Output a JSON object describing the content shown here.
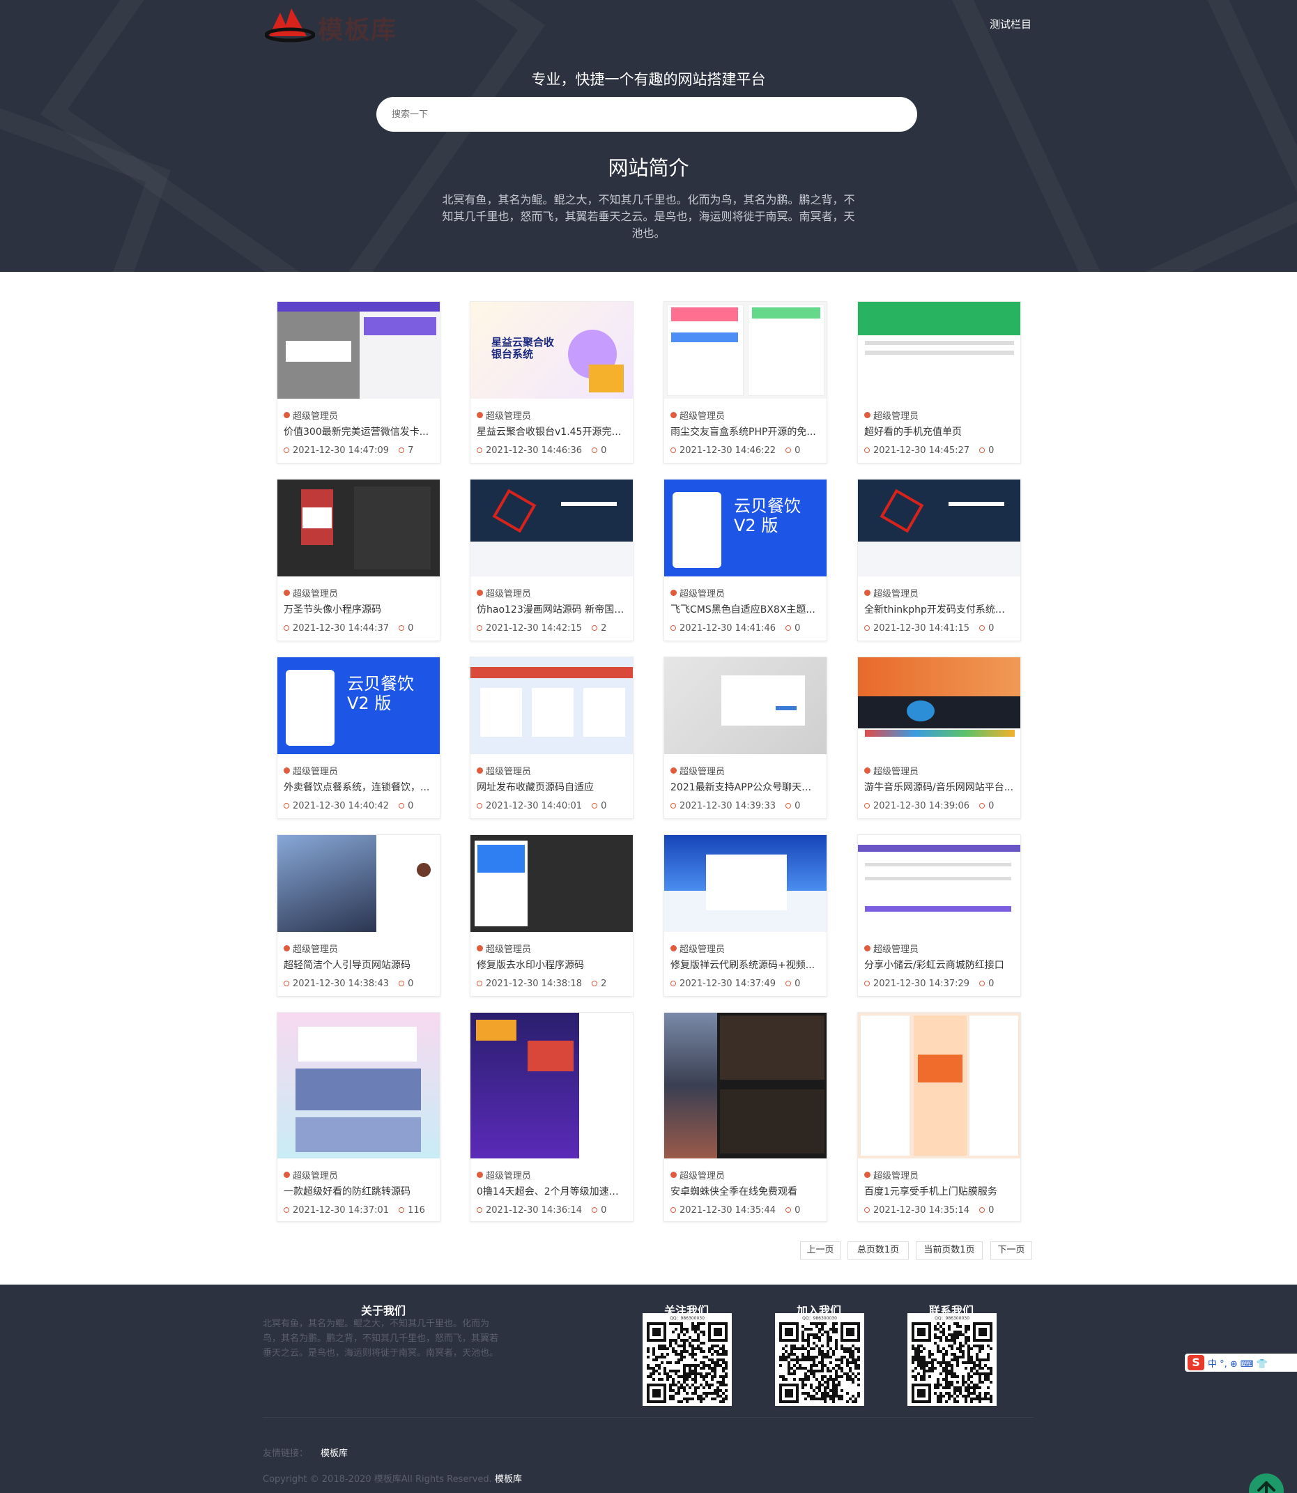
{
  "header": {
    "logo_text": "模板库",
    "nav": [
      "测试栏目"
    ],
    "slogan": "专业，快捷一个有趣的网站搭建平台",
    "search_placeholder": "搜索一下",
    "intro_title": "网站简介",
    "intro_text": "北冥有鱼，其名为鲲。鲲之大，不知其几千里也。化而为鸟，其名为鹏。鹏之背，不知其几千里也，怒而飞，其翼若垂天之云。是鸟也，海运则将徙于南冥。南冥者，天池也。"
  },
  "cards": [
    {
      "author": "超级管理员",
      "title": "价值300最新完美运营微信发卡...",
      "date": "2021-12-30 14:47:09",
      "views": "7",
      "thumb_theme": "purple-ui"
    },
    {
      "author": "超级管理员",
      "title": "星益云聚合收银台v1.45开源完整...",
      "date": "2021-12-30 14:46:36",
      "views": "0",
      "thumb_theme": "pay-banner"
    },
    {
      "author": "超级管理员",
      "title": "雨尘交友盲盒系统PHP开源的免...",
      "date": "2021-12-30 14:46:22",
      "views": "0",
      "thumb_theme": "mobile-grid"
    },
    {
      "author": "超级管理员",
      "title": "超好看的手机充值单页",
      "date": "2021-12-30 14:45:27",
      "views": "0",
      "thumb_theme": "green-page"
    },
    {
      "author": "超级管理员",
      "title": "万圣节头像小程序源码",
      "date": "2021-12-30 14:44:37",
      "views": "0",
      "thumb_theme": "dark-code"
    },
    {
      "author": "超级管理员",
      "title": "仿hao123漫画网站源码 新帝国C...",
      "date": "2021-12-30 14:42:15",
      "views": "2",
      "thumb_theme": "dark-cube"
    },
    {
      "author": "超级管理员",
      "title": "飞飞CMS黑色自适应BX8X主题...",
      "date": "2021-12-30 14:41:46",
      "views": "0",
      "thumb_theme": "blue-food"
    },
    {
      "author": "超级管理员",
      "title": "全新thinkphp开发码支付系统三...",
      "date": "2021-12-30 14:41:15",
      "views": "0",
      "thumb_theme": "dark-cube"
    },
    {
      "author": "超级管理员",
      "title": "外卖餐饮点餐系统，连锁餐饮，...",
      "date": "2021-12-30 14:40:42",
      "views": "0",
      "thumb_theme": "blue-food"
    },
    {
      "author": "超级管理员",
      "title": "网址发布收藏页源码自适应",
      "date": "2021-12-30 14:40:01",
      "views": "0",
      "thumb_theme": "light-blue"
    },
    {
      "author": "超级管理员",
      "title": "2021最新支持APP公众号聊天在...",
      "date": "2021-12-30 14:39:33",
      "views": "0",
      "thumb_theme": "grey-login"
    },
    {
      "author": "超级管理员",
      "title": "游牛音乐网源码/音乐网网站平台...",
      "date": "2021-12-30 14:39:06",
      "views": "0",
      "thumb_theme": "orange-music"
    },
    {
      "author": "超级管理员",
      "title": "超轻简洁个人引导页网站源码",
      "date": "2021-12-30 14:38:43",
      "views": "0",
      "thumb_theme": "anime-profile"
    },
    {
      "author": "超级管理员",
      "title": "修复版去水印小程序源码",
      "date": "2021-12-30 14:38:18",
      "views": "2",
      "thumb_theme": "dark-phone"
    },
    {
      "author": "超级管理员",
      "title": "修复版祥云代刷系统源码+视频...",
      "date": "2021-12-30 14:37:49",
      "views": "0",
      "thumb_theme": "blue-shop"
    },
    {
      "author": "超级管理员",
      "title": "分享小储云/彩虹云商城防红接口",
      "date": "2021-12-30 14:37:29",
      "views": "0",
      "thumb_theme": "purple-form"
    },
    {
      "author": "超级管理员",
      "title": "一款超级好看的防红跳转源码",
      "date": "2021-12-30 14:37:01",
      "views": "116",
      "thumb_theme": "anime-pink"
    },
    {
      "author": "超级管理员",
      "title": "0撸14天超会、2个月等级加速包...",
      "date": "2021-12-30 14:36:14",
      "views": "0",
      "thumb_theme": "game-promo"
    },
    {
      "author": "超级管理员",
      "title": "安卓蜘蛛侠全季在线免费观看",
      "date": "2021-12-30 14:35:44",
      "views": "0",
      "thumb_theme": "movie-grid"
    },
    {
      "author": "超级管理员",
      "title": "百度1元享受手机上门贴膜服务",
      "date": "2021-12-30 14:35:14",
      "views": "0",
      "thumb_theme": "mobile-store"
    }
  ],
  "pagination": {
    "prev": "上一页",
    "total": "总页数1页",
    "current": "当前页数1页",
    "next": "下一页"
  },
  "footer": {
    "about_title": "关于我们",
    "about_text": "北冥有鱼，其名为鲲。鲲之大，不知其几千里也。化而为鸟，其名为鹏。鹏之背，不知其几千里也，怒而飞，其翼若垂天之云。是鸟也，海运则将徙于南冥。南冥者，天池也。",
    "qr_blocks": [
      {
        "title": "关注我们",
        "caption": "QQ：986300030"
      },
      {
        "title": "加入我们",
        "caption": "QQ：986300030"
      },
      {
        "title": "联系我们",
        "caption": "QQ：986300030"
      }
    ],
    "links_label": "友情链接：",
    "links": [
      "模板库"
    ],
    "copyright": "Copyright © 2018-2020 模板库All Rights Reserved.",
    "copyright_link": "模板库"
  },
  "ime": {
    "label": "中 °, ⊕ ⌨ 👕"
  },
  "colors": {
    "header_bg": "#2d3240",
    "accent": "#e15b3c",
    "to_top": "#1e9a6a"
  }
}
